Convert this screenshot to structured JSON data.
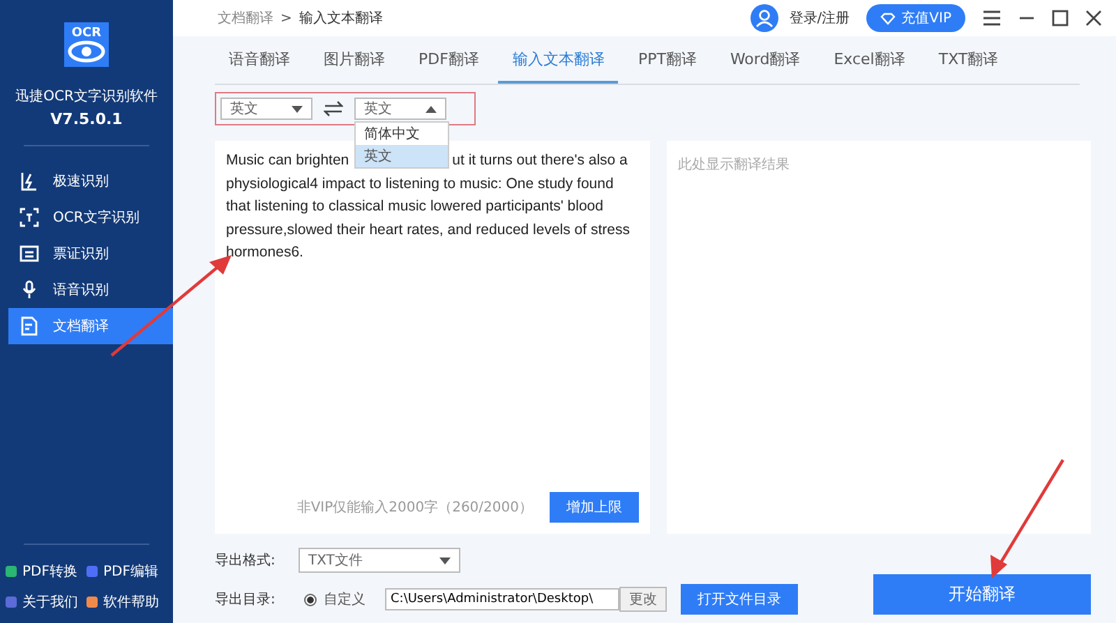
{
  "app": {
    "name": "迅捷OCR文字识别软件",
    "version": "V7.5.0.1",
    "logo": "OCR"
  },
  "sidebar": {
    "items": [
      {
        "label": "极速识别",
        "kind": "fast",
        "selected": false
      },
      {
        "label": "OCR文字识别",
        "kind": "ocr",
        "selected": false
      },
      {
        "label": "票证识别",
        "kind": "ticket",
        "selected": false
      },
      {
        "label": "语音识别",
        "kind": "voice",
        "selected": false
      },
      {
        "label": "文档翻译",
        "kind": "document",
        "selected": true
      }
    ],
    "footer": [
      {
        "label": "PDF转换",
        "color": "#2bb673"
      },
      {
        "label": "PDF编辑",
        "color": "#4f6ef7"
      },
      {
        "label": "关于我们",
        "color": "#5b6bd8"
      },
      {
        "label": "软件帮助",
        "color": "#f08a4b"
      }
    ]
  },
  "breadcrumb": [
    "文档翻译",
    ">",
    "输入文本翻译"
  ],
  "header": {
    "login": "登录/注册",
    "vip": "充值VIP"
  },
  "tabs": [
    {
      "label": "语音翻译",
      "selected": false
    },
    {
      "label": "图片翻译",
      "selected": false
    },
    {
      "label": "PDF翻译",
      "selected": false
    },
    {
      "label": "输入文本翻译",
      "selected": true
    },
    {
      "label": "PPT翻译",
      "selected": false
    },
    {
      "label": "Word翻译",
      "selected": false
    },
    {
      "label": "Excel翻译",
      "selected": false
    },
    {
      "label": "TXT翻译",
      "selected": false
    }
  ],
  "source_language": {
    "value": "英文",
    "expanded": false
  },
  "target_language": {
    "value": "英文",
    "expanded": true,
    "options": [
      {
        "label": "简体中文",
        "selected": false
      },
      {
        "label": "英文",
        "selected": true
      }
    ]
  },
  "input_text": {
    "start": "Music can brighten",
    "line1_end": "ut it turns out there's also a",
    "rest": "physiological4 impact to listening to music: One study found that listening to classical music lowered participants' blood pressure,slowed their heart rates, and reduced levels of stress hormones6."
  },
  "limit_note": "非VIP仅能输入2000字（260/2000）",
  "increase_button": "增加上限",
  "output": {
    "placeholder": "此处显示翻译结果"
  },
  "export_format": {
    "label": "导出格式:",
    "value": "TXT文件"
  },
  "export_dir": {
    "label": "导出目录:",
    "option": "自定义",
    "checked": true,
    "path": "C:\\Users\\Administrator\\Desktop\\",
    "change": "更改",
    "open": "打开文件目录"
  },
  "start_button": "开始翻译"
}
